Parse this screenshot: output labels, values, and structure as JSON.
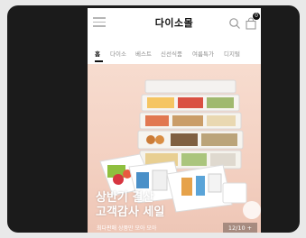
{
  "header": {
    "logo": "다이소몰",
    "menu_icon": "hamburger-menu-icon",
    "search_icon": "search-icon",
    "cart_icon": "shopping-bag-icon",
    "cart_count": "0"
  },
  "tabs": [
    {
      "label": "홈",
      "active": true
    },
    {
      "label": "다이소",
      "active": false
    },
    {
      "label": "베스트",
      "active": false
    },
    {
      "label": "신선식품",
      "active": false
    },
    {
      "label": "여름특가",
      "active": false
    },
    {
      "label": "디지털",
      "active": false
    }
  ],
  "banner": {
    "title_line1": "상반기 결산",
    "title_line2": "고객감사 세일",
    "subtitle": "최다판매 상품만 모아 모아",
    "counter": "12/10 +",
    "bg_color": "#f3d0c1"
  },
  "colors": {
    "frame": "#1b1b1b",
    "active_tab": "#111111",
    "inactive_tab": "#8e8e8e"
  }
}
